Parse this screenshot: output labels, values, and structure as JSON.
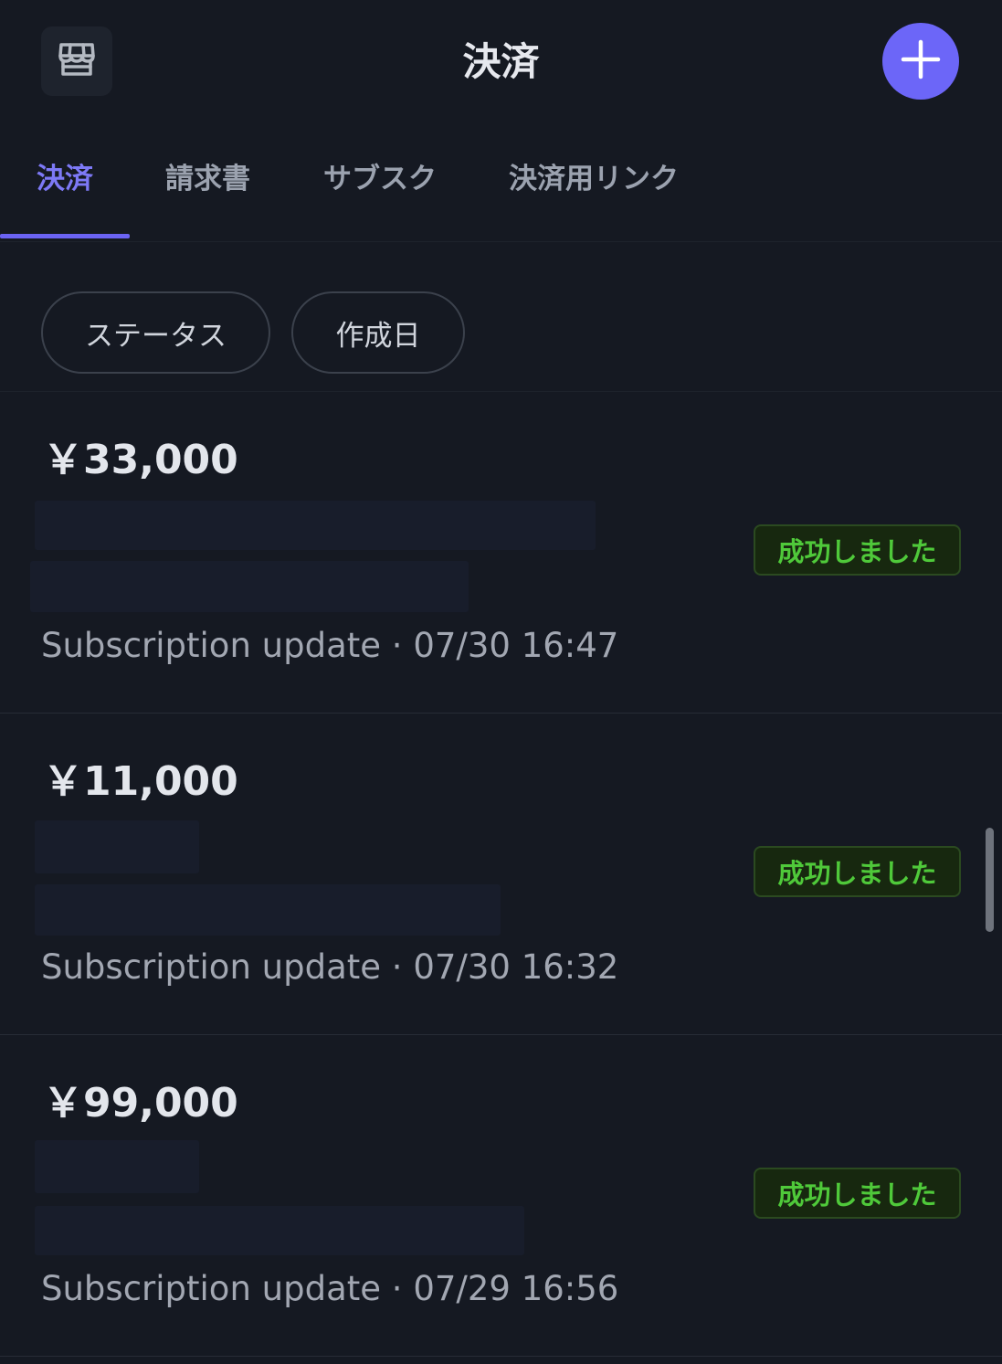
{
  "header": {
    "title": "決済",
    "store_icon": "store-icon",
    "add_icon": "plus-icon"
  },
  "tabs": [
    {
      "label": "決済",
      "active": true
    },
    {
      "label": "請求書",
      "active": false
    },
    {
      "label": "サブスク",
      "active": false
    },
    {
      "label": "決済用リンク",
      "active": false
    }
  ],
  "filters": [
    {
      "label": "ステータス"
    },
    {
      "label": "作成日"
    }
  ],
  "payments": [
    {
      "amount": "￥33,000",
      "status": "成功しました",
      "description": "Subscription update",
      "separator": "·",
      "datetime": "07/30 16:47"
    },
    {
      "amount": "￥11,000",
      "status": "成功しました",
      "description": "Subscription update",
      "separator": "·",
      "datetime": "07/30 16:32"
    },
    {
      "amount": "￥99,000",
      "status": "成功しました",
      "description": "Subscription update",
      "separator": "·",
      "datetime": "07/29 16:56"
    }
  ],
  "colors": {
    "background": "#151922",
    "accent": "#6c66f8",
    "success_text": "#4fc93a",
    "success_bg": "#17280f"
  }
}
